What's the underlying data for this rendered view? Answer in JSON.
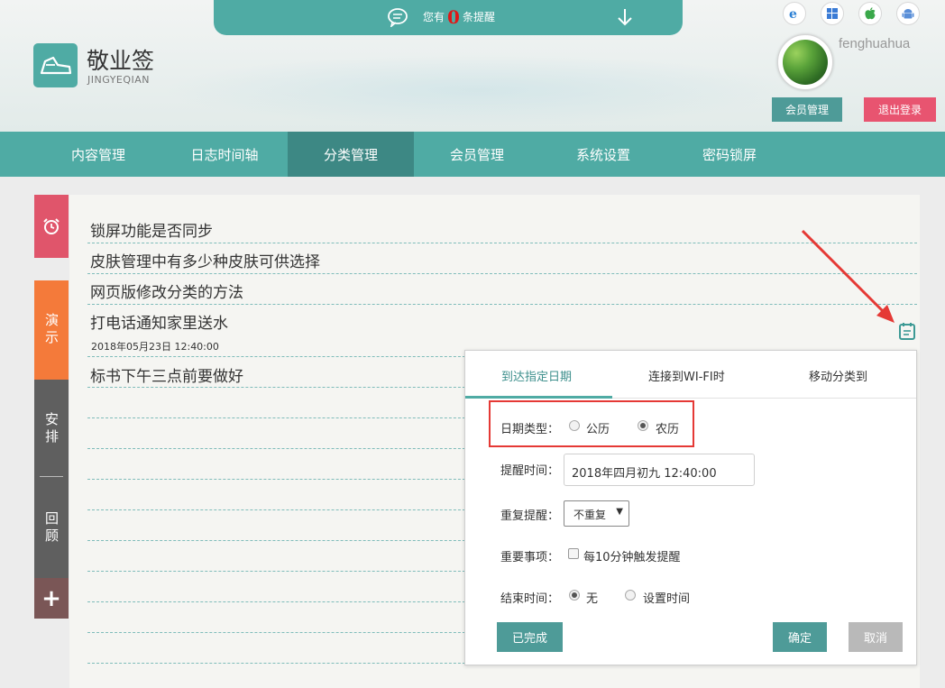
{
  "header": {
    "notice_prefix": "您有",
    "notice_count": "0",
    "notice_suffix": "条提醒",
    "brand": "敬业签",
    "brand_sub": "JINGYEQIAN",
    "platform_icons": [
      "ie-icon",
      "windows-icon",
      "apple-icon",
      "android-icon"
    ],
    "username": "fenghuahua",
    "member_button": "会员管理",
    "logout_button": "退出登录"
  },
  "nav": {
    "items": [
      {
        "label": "内容管理"
      },
      {
        "label": "日志时间轴"
      },
      {
        "label": "分类管理"
      },
      {
        "label": "会员管理"
      },
      {
        "label": "系统设置"
      },
      {
        "label": "密码锁屏"
      }
    ],
    "active_index": 2
  },
  "sidebar": {
    "demo_label": "演示",
    "arrange_label": "安排",
    "review_label": "回顾",
    "add_label": "+"
  },
  "notes": {
    "items": [
      {
        "text": "锁屏功能是否同步"
      },
      {
        "text": "皮肤管理中有多少种皮肤可供选择"
      },
      {
        "text": "网页版修改分类的方法"
      },
      {
        "text": "打电话通知家里送水",
        "date": "2018年05月23日 12:40:00"
      },
      {
        "text": "标书下午三点前要做好"
      }
    ]
  },
  "popup": {
    "tabs": [
      {
        "label": "到达指定日期"
      },
      {
        "label": "连接到WI-FI时"
      },
      {
        "label": "移动分类到"
      }
    ],
    "date_type_label": "日期类型：",
    "date_type_options": [
      "公历",
      "农历"
    ],
    "date_type_selected": "农历",
    "remind_time_label": "提醒时间：",
    "remind_time_value": "2018年四月初九 12:40:00",
    "repeat_label": "重复提醒：",
    "repeat_value": "不重复",
    "important_label": "重要事项：",
    "important_checkbox_label": "每10分钟触发提醒",
    "end_time_label": "结束时间：",
    "end_time_options": [
      "无",
      "设置时间"
    ],
    "end_time_selected": "无",
    "done_button": "已完成",
    "ok_button": "确定",
    "cancel_button": "取消"
  },
  "colors": {
    "accent": "#4faba4",
    "nav_active": "#3d8884",
    "alarm_tab": "#e0556b",
    "demo_tab": "#f47a3a",
    "logout": "#e85470",
    "highlight_box": "#e53935"
  }
}
